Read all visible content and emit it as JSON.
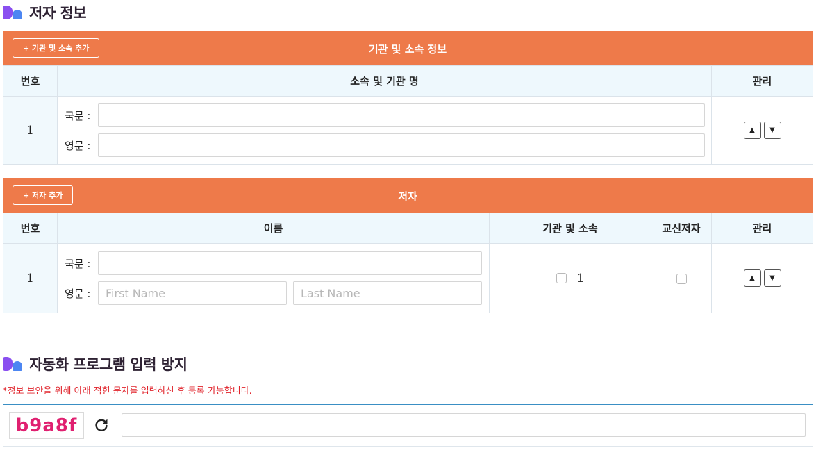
{
  "author_section": {
    "title": "저자 정보"
  },
  "affiliation_table": {
    "add_button": "+ 기관 및 소속 추가",
    "title": "기관 및 소속 정보",
    "headers": {
      "num": "번호",
      "name": "소속 및 기관 명",
      "manage": "관리"
    },
    "rows": [
      {
        "num": "1",
        "korean_label": "국문 :",
        "english_label": "영문 :",
        "korean_value": "",
        "english_value": ""
      }
    ]
  },
  "author_table": {
    "add_button": "+ 저자 추가",
    "title": "저자",
    "headers": {
      "num": "번호",
      "name": "이름",
      "affiliation": "기관 및 소속",
      "corresponding": "교신저자",
      "manage": "관리"
    },
    "rows": [
      {
        "num": "1",
        "korean_label": "국문 :",
        "english_label": "영문 :",
        "korean_value": "",
        "first_name_placeholder": "First Name",
        "last_name_placeholder": "Last Name",
        "affiliation_option": "1"
      }
    ]
  },
  "captcha_section": {
    "title": "자동화 프로그램 입력 방지",
    "notice": "*정보 보안을 위해 아래 적힌 문자를 입력하신 후 등록 가능합니다.",
    "captcha_text": "b9a8f",
    "input_value": ""
  },
  "icons": {
    "move_up": "▲",
    "move_down": "▼",
    "refresh": "refresh-icon"
  },
  "colors": {
    "accent": "#ee7a4a",
    "header_bg": "#eef8fd",
    "notice": "#e0222a",
    "captcha_text": "#e02070"
  }
}
